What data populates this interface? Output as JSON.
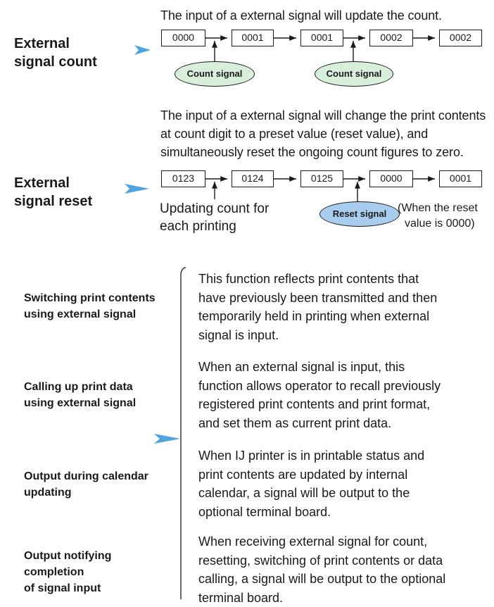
{
  "external_signal_count": {
    "title_line1": "External",
    "title_line2": "signal count",
    "caption": "The input of a external signal will update the count.",
    "boxes": [
      "0000",
      "0001",
      "0001",
      "0002",
      "0002"
    ],
    "signal_label": "Count signal"
  },
  "external_signal_reset": {
    "title_line1": "External",
    "title_line2": "signal reset",
    "caption_lines": [
      "The input of a external signal will change the print contents",
      "at count digit to a preset value (reset value), and",
      "simultaneously reset the ongoing count figures to zero."
    ],
    "boxes": [
      "0123",
      "0124",
      "0125",
      "0000",
      "0001"
    ],
    "updating_note_line1": "Updating count for",
    "updating_note_line2": "each printing",
    "signal_label": "Reset signal",
    "reset_note_line1": "(When the reset",
    "reset_note_line2": "value is 0000)"
  },
  "features": [
    {
      "title_lines": [
        "Switching print contents",
        "using external signal"
      ],
      "desc_lines": [
        "This function reflects print contents that",
        "have previously been transmitted and then",
        "temporarily held in printing when external",
        "signal is input."
      ]
    },
    {
      "title_lines": [
        "Calling up print data",
        "using external signal"
      ],
      "desc_lines": [
        "When an external signal is input, this",
        "function allows operator to recall previously",
        "registered print contents and print format,",
        "and set them as current print data."
      ]
    },
    {
      "title_lines": [
        "Output during calendar",
        "updating"
      ],
      "desc_lines": [
        "When IJ printer is in printable status and",
        "print contents are updated by internal",
        "calendar, a signal will be output to the",
        "optional terminal board."
      ]
    },
    {
      "title_lines": [
        "Output notifying",
        "completion",
        "of signal input"
      ],
      "desc_lines": [
        "When receiving external signal for count,",
        "resetting, switching of print contents or data",
        "calling, a signal will be output to the optional",
        "terminal board."
      ]
    }
  ],
  "colors": {
    "pointer_arrow": "#4fa3df",
    "count_signal_fill": "#d8efdc",
    "reset_signal_fill": "#a9cdee"
  }
}
